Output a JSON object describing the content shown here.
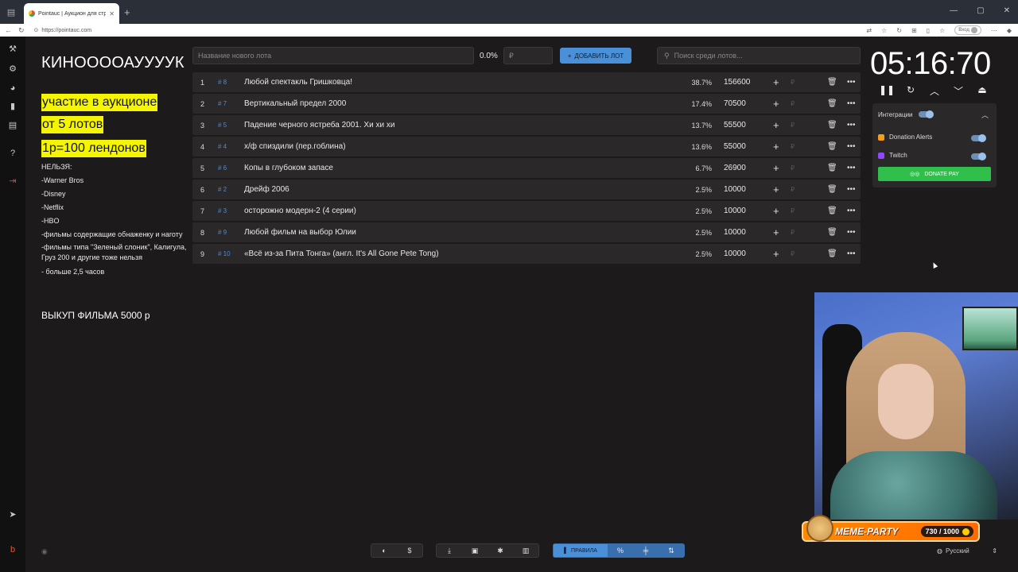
{
  "browser": {
    "tab_title": "Pointauc | Аукцион для стриме...",
    "url": "https://pointauc.com",
    "login_label": "Вход"
  },
  "rules_panel": {
    "title": "КИНООООАУУУУК",
    "highlights": [
      "участие в аукционе",
      "от 5 лотов",
      "1р=100 лендонов"
    ],
    "forbidden_header": "НЕЛЬЗЯ:",
    "forbidden": [
      "-Warner Bros",
      "-Disney",
      "-Netflix",
      "-HBO",
      "-фильмы содержащие обнаженку и наготу",
      "-фильмы типа \"Зеленый слоник\", Калигула, Груз 200 и другие тоже нельзя",
      "- больше 2,5 часов"
    ],
    "buyout": "ВЫКУП ФИЛЬМА 5000 р"
  },
  "controls": {
    "lot_placeholder": "Название нового лота",
    "percent": "0.0%",
    "amount_placeholder": "₽",
    "add_button": "ДОБАВИТЬ ЛОТ",
    "search_placeholder": "Поиск среди лотов..."
  },
  "lots": [
    {
      "num": "1",
      "id": "# 8",
      "name": "Любой спектакль Гришковца!",
      "percent": "38.7%",
      "amount": "156600"
    },
    {
      "num": "2",
      "id": "# 7",
      "name": "Вертикальный предел 2000",
      "percent": "17.4%",
      "amount": "70500"
    },
    {
      "num": "3",
      "id": "# 5",
      "name": "Падение черного ястреба 2001.  Хи  хи  хи",
      "percent": "13.7%",
      "amount": "55500"
    },
    {
      "num": "4",
      "id": "# 4",
      "name": "х/ф спиздили (пер.гоблина)",
      "percent": "13.6%",
      "amount": "55000"
    },
    {
      "num": "5",
      "id": "# 6",
      "name": "Копы в глубоком запасе",
      "percent": "6.7%",
      "amount": "26900"
    },
    {
      "num": "6",
      "id": "# 2",
      "name": "Дрейф 2006",
      "percent": "2.5%",
      "amount": "10000"
    },
    {
      "num": "7",
      "id": "# 3",
      "name": "осторожно модерн-2 (4 серии)",
      "percent": "2.5%",
      "amount": "10000"
    },
    {
      "num": "8",
      "id": "# 9",
      "name": "Любой фильм на выбор Юлии",
      "percent": "2.5%",
      "amount": "10000"
    },
    {
      "num": "9",
      "id": "# 10",
      "name": "«Всё из-за Пита Тонга» (англ. It's All Gone Pete Tong)",
      "percent": "2.5%",
      "amount": "10000"
    }
  ],
  "lot_currency": "₽",
  "timer": {
    "display": "05:16:70"
  },
  "integrations": {
    "title": "Интеграции",
    "items": [
      {
        "name": "Donation Alerts",
        "color": "#f59c1a"
      },
      {
        "name": "Twitch",
        "color": "#9146ff"
      }
    ],
    "donate_button": "DONATE PAY"
  },
  "overlay": {
    "meme_label": "MEME-PARTY",
    "meme_count": "730 / 1000"
  },
  "language": {
    "selected": "Русский"
  },
  "toolbar": {
    "rules_label": "ПРАВИЛА"
  }
}
